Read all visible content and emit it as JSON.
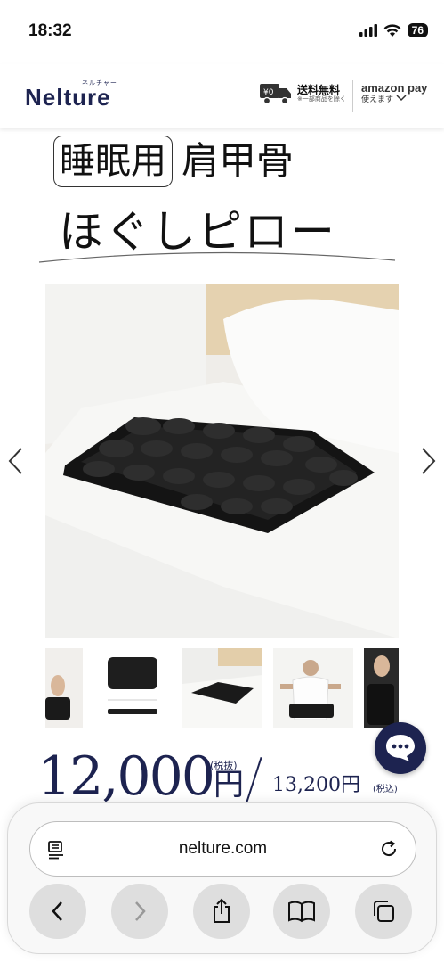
{
  "status_bar": {
    "time": "18:32",
    "battery": "76"
  },
  "header": {
    "logo": "Nelture",
    "logo_kana": "ネルチャー",
    "shipping_badge": "¥0",
    "shipping_label": "送料無料",
    "shipping_note": "※一部商品を除く",
    "amazon_label": "amazon pay",
    "amazon_sub": "使えます"
  },
  "title": {
    "boxed": "睡眠用",
    "rest": "肩甲骨",
    "line2": "ほぐしピロー"
  },
  "price": {
    "main": "12,000",
    "yen": "円",
    "tax_excl": "(税抜)",
    "alt": "13,200円",
    "tax_incl": "(税込)"
  },
  "browser": {
    "url": "nelture.com"
  },
  "colors": {
    "brand_navy": "#1d2350",
    "toolbar_btn": "#dedede"
  },
  "icons": {
    "signal": "signal-icon",
    "wifi": "wifi-icon",
    "truck": "truck-icon",
    "chat": "chat-icon",
    "reader": "reader-icon",
    "reload": "reload-icon",
    "back": "back-icon",
    "forward": "forward-icon",
    "share": "share-icon",
    "bookmarks": "bookmarks-icon",
    "tabs": "tabs-icon"
  }
}
